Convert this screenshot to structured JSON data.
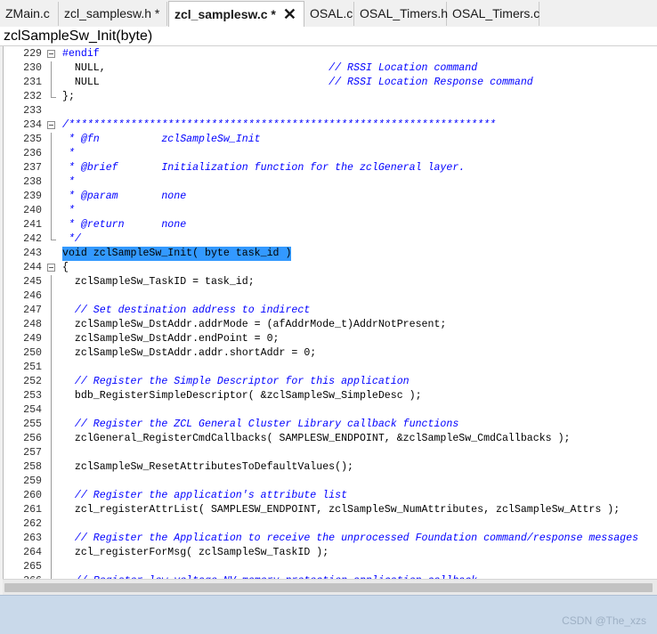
{
  "tabs": [
    {
      "label": "ZMain.c",
      "active": false
    },
    {
      "label": "zcl_samplesw.h *",
      "active": false
    },
    {
      "label": "zcl_samplesw.c *",
      "active": true,
      "close_icon": "close-icon"
    },
    {
      "label": "OSAL.c",
      "active": false
    },
    {
      "label": "OSAL_Timers.h",
      "active": false
    },
    {
      "label": "OSAL_Timers.c",
      "active": false
    }
  ],
  "function_bar": {
    "label": "zclSampleSw_Init(byte)"
  },
  "editor": {
    "lines": [
      {
        "num": "229",
        "text": "#endif",
        "style": "kw",
        "fold": "foldbox"
      },
      {
        "num": "230",
        "text": "  NULL,                                    // RSSI Location command",
        "style": "mixed",
        "fold": "line"
      },
      {
        "num": "231",
        "text": "  NULL                                     // RSSI Location Response command",
        "style": "mixed",
        "fold": "line"
      },
      {
        "num": "232",
        "text": "};",
        "style": "code",
        "fold": "end"
      },
      {
        "num": "233",
        "text": "",
        "style": "code",
        "fold": ""
      },
      {
        "num": "234",
        "text": "/*********************************************************************",
        "style": "comment",
        "fold": "foldbox"
      },
      {
        "num": "235",
        "text": " * @fn          zclSampleSw_Init",
        "style": "comment",
        "fold": "line"
      },
      {
        "num": "236",
        "text": " *",
        "style": "comment",
        "fold": "line"
      },
      {
        "num": "237",
        "text": " * @brief       Initialization function for the zclGeneral layer.",
        "style": "comment",
        "fold": "line"
      },
      {
        "num": "238",
        "text": " *",
        "style": "comment",
        "fold": "line"
      },
      {
        "num": "239",
        "text": " * @param       none",
        "style": "comment",
        "fold": "line"
      },
      {
        "num": "240",
        "text": " *",
        "style": "comment",
        "fold": "line"
      },
      {
        "num": "241",
        "text": " * @return      none",
        "style": "comment",
        "fold": "line"
      },
      {
        "num": "242",
        "text": " */",
        "style": "comment",
        "fold": "end"
      },
      {
        "num": "243",
        "text": "void zclSampleSw_Init( byte task_id )",
        "style": "sel",
        "fold": ""
      },
      {
        "num": "244",
        "text": "{",
        "style": "code",
        "fold": "foldbox"
      },
      {
        "num": "245",
        "text": "  zclSampleSw_TaskID = task_id;",
        "style": "code",
        "fold": "line"
      },
      {
        "num": "246",
        "text": "",
        "style": "code",
        "fold": "line"
      },
      {
        "num": "247",
        "text": "  // Set destination address to indirect",
        "style": "comment",
        "fold": "line"
      },
      {
        "num": "248",
        "text": "  zclSampleSw_DstAddr.addrMode = (afAddrMode_t)AddrNotPresent;",
        "style": "code",
        "fold": "line"
      },
      {
        "num": "249",
        "text": "  zclSampleSw_DstAddr.endPoint = 0;",
        "style": "code",
        "fold": "line"
      },
      {
        "num": "250",
        "text": "  zclSampleSw_DstAddr.addr.shortAddr = 0;",
        "style": "code",
        "fold": "line"
      },
      {
        "num": "251",
        "text": "",
        "style": "code",
        "fold": "line"
      },
      {
        "num": "252",
        "text": "  // Register the Simple Descriptor for this application",
        "style": "comment",
        "fold": "line"
      },
      {
        "num": "253",
        "text": "  bdb_RegisterSimpleDescriptor( &zclSampleSw_SimpleDesc );",
        "style": "code",
        "fold": "line"
      },
      {
        "num": "254",
        "text": "",
        "style": "code",
        "fold": "line"
      },
      {
        "num": "255",
        "text": "  // Register the ZCL General Cluster Library callback functions",
        "style": "comment",
        "fold": "line"
      },
      {
        "num": "256",
        "text": "  zclGeneral_RegisterCmdCallbacks( SAMPLESW_ENDPOINT, &zclSampleSw_CmdCallbacks );",
        "style": "code",
        "fold": "line"
      },
      {
        "num": "257",
        "text": "",
        "style": "code",
        "fold": "line"
      },
      {
        "num": "258",
        "text": "  zclSampleSw_ResetAttributesToDefaultValues();",
        "style": "code",
        "fold": "line"
      },
      {
        "num": "259",
        "text": "",
        "style": "code",
        "fold": "line"
      },
      {
        "num": "260",
        "text": "  // Register the application's attribute list",
        "style": "comment",
        "fold": "line"
      },
      {
        "num": "261",
        "text": "  zcl_registerAttrList( SAMPLESW_ENDPOINT, zclSampleSw_NumAttributes, zclSampleSw_Attrs );",
        "style": "code",
        "fold": "line"
      },
      {
        "num": "262",
        "text": "",
        "style": "code",
        "fold": "line"
      },
      {
        "num": "263",
        "text": "  // Register the Application to receive the unprocessed Foundation command/response messages",
        "style": "comment",
        "fold": "line"
      },
      {
        "num": "264",
        "text": "  zcl_registerForMsg( zclSampleSw_TaskID );",
        "style": "code",
        "fold": "line"
      },
      {
        "num": "265",
        "text": "",
        "style": "code",
        "fold": "line"
      },
      {
        "num": "266",
        "text": "  // Register low voltage NV memory protection application callback",
        "style": "comment",
        "fold": "line"
      }
    ]
  },
  "watermark": "CSDN @The_xzs"
}
